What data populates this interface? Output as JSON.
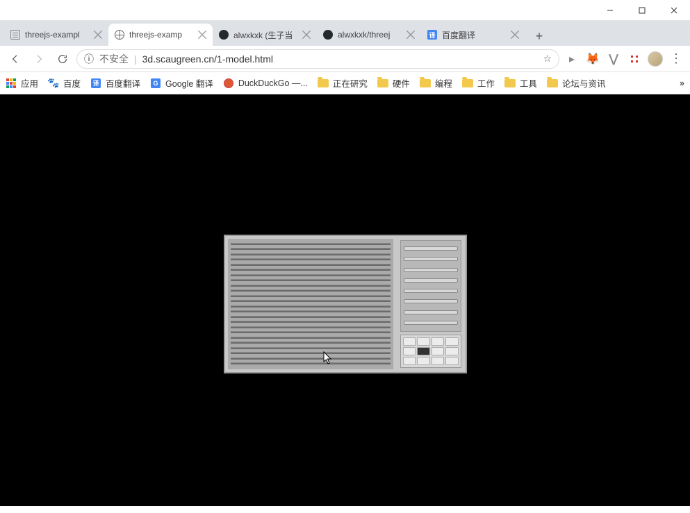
{
  "window": {
    "minimize": "—",
    "maximize": "□",
    "close": "✕"
  },
  "tabs": [
    {
      "title": "threejs-exampl",
      "favicon": "document-icon",
      "active": false
    },
    {
      "title": "threejs-examp",
      "favicon": "globe-icon",
      "active": true
    },
    {
      "title": "alwxkxk (生子当",
      "favicon": "github-icon",
      "active": false
    },
    {
      "title": "alwxkxk/threej",
      "favicon": "github-icon",
      "active": false
    },
    {
      "title": "百度翻译",
      "favicon": "translate-icon",
      "active": false
    }
  ],
  "newtab_label": "+",
  "nav": {
    "back": "←",
    "forward": "→",
    "reload": "⟳"
  },
  "omnibox": {
    "security_icon": "ⓘ",
    "security_label": "不安全",
    "separator": "|",
    "url": "3d.scaugreen.cn/1-model.html",
    "star": "☆"
  },
  "toolbar_right": {
    "play": "▸",
    "ext1": "🦊",
    "ext2": "⋁",
    "ext3_color": "#d32f2f",
    "menu": "⋮"
  },
  "bookmarks": [
    {
      "icon": "apps",
      "label": "应用"
    },
    {
      "icon": "baidu",
      "label": "百度"
    },
    {
      "icon": "translate",
      "label": "百度翻译"
    },
    {
      "icon": "google",
      "label": "Google 翻译"
    },
    {
      "icon": "ddg",
      "label": "DuckDuckGo —..."
    },
    {
      "icon": "folder",
      "label": "正在研究"
    },
    {
      "icon": "folder",
      "label": "硬件"
    },
    {
      "icon": "folder",
      "label": "编程"
    },
    {
      "icon": "folder",
      "label": "工作"
    },
    {
      "icon": "folder",
      "label": "工具"
    },
    {
      "icon": "folder",
      "label": "论坛与资讯"
    }
  ],
  "bm_overflow": "»",
  "content": {
    "model_name": "air-conditioner-unit"
  }
}
